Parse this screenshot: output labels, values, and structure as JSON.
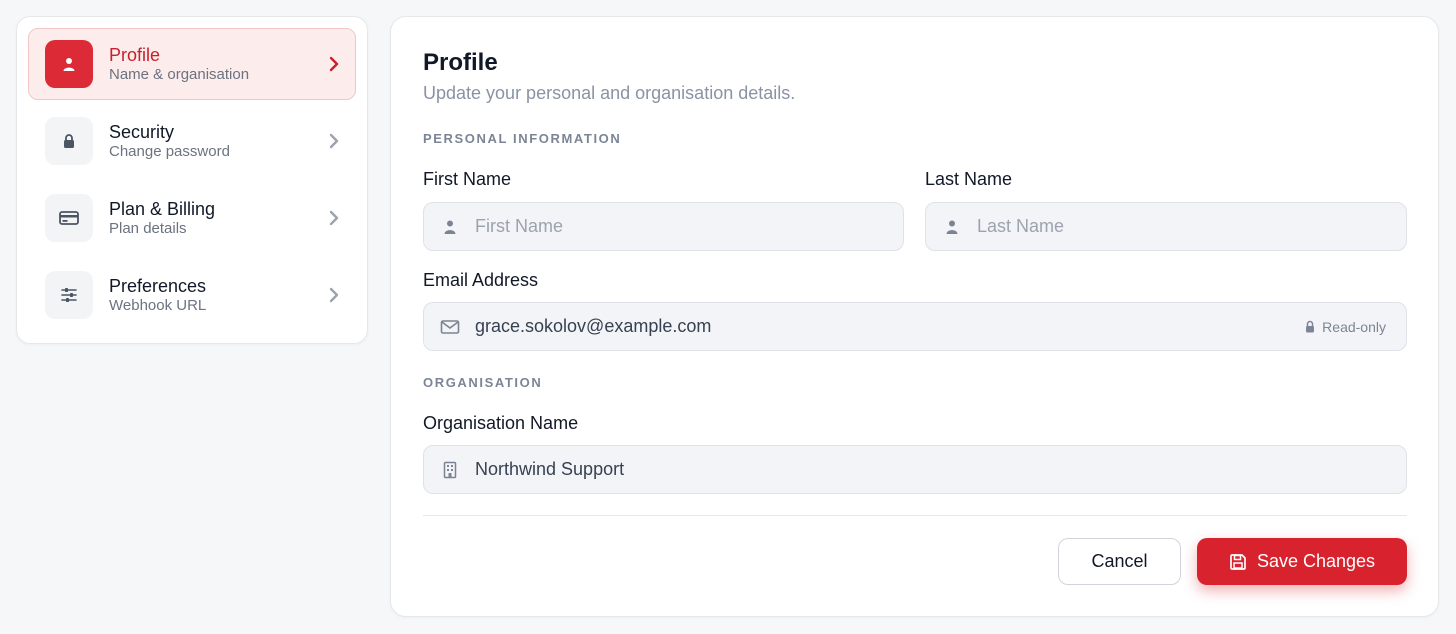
{
  "sidebar": {
    "items": [
      {
        "label": "Profile",
        "sub": "Name & organisation",
        "icon": "user-icon",
        "active": true
      },
      {
        "label": "Security",
        "sub": "Change password",
        "icon": "lock-icon",
        "active": false
      },
      {
        "label": "Plan & Billing",
        "sub": "Plan details",
        "icon": "credit-card-icon",
        "active": false
      },
      {
        "label": "Preferences",
        "sub": "Webhook URL",
        "icon": "sliders-icon",
        "active": false
      }
    ]
  },
  "main": {
    "title": "Profile",
    "subtitle": "Update your personal and organisation details.",
    "personal_section": "PERSONAL INFORMATION",
    "first_name": {
      "label": "First Name",
      "placeholder": "First Name",
      "value": ""
    },
    "last_name": {
      "label": "Last Name",
      "placeholder": "Last Name",
      "value": ""
    },
    "email": {
      "label": "Email Address",
      "value": "grace.sokolov@example.com",
      "badge": "Read-only"
    },
    "org_section": "ORGANISATION",
    "org_name": {
      "label": "Organisation Name",
      "value": "Northwind Support"
    },
    "cancel_label": "Cancel",
    "save_label": "Save Changes"
  },
  "colors": {
    "accent": "#d8232f",
    "accent_light": "#fdecec",
    "input_bg": "#f3f4f7"
  }
}
